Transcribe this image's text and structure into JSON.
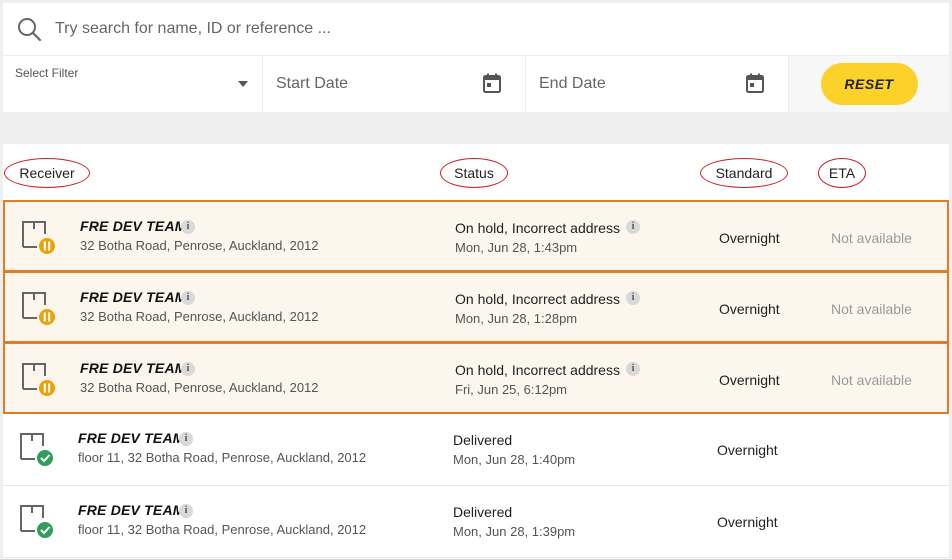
{
  "search": {
    "placeholder": "Try search for name, ID or reference ..."
  },
  "filters": {
    "select_label": "Select Filter",
    "start_date_placeholder": "Start Date",
    "end_date_placeholder": "End Date",
    "reset_label": "RESET"
  },
  "colors": {
    "accent": "#fcd12a",
    "on_hold": "#e8a30c",
    "delivered": "#2e9e5b",
    "highlight_border": "#e07b26",
    "annotation": "#d0202a"
  },
  "table": {
    "headers": {
      "receiver": "Receiver",
      "status": "Status",
      "standard": "Standard",
      "eta": "ETA"
    },
    "rows": [
      {
        "name": "FRE DEV TEAM",
        "address": "32 Botha Road, Penrose, Auckland, 2012",
        "status": "On hold, Incorrect address",
        "status_time": "Mon, Jun 28, 1:43pm",
        "standard": "Overnight",
        "eta": "Not available",
        "state_icon": "pause-icon"
      },
      {
        "name": "FRE DEV TEAM",
        "address": "32 Botha Road, Penrose, Auckland, 2012",
        "status": "On hold, Incorrect address",
        "status_time": "Mon, Jun 28, 1:28pm",
        "standard": "Overnight",
        "eta": "Not available",
        "state_icon": "pause-icon"
      },
      {
        "name": "FRE DEV TEAM",
        "address": "32 Botha Road, Penrose, Auckland, 2012",
        "status": "On hold, Incorrect address",
        "status_time": "Fri, Jun 25, 6:12pm",
        "standard": "Overnight",
        "eta": "Not available",
        "state_icon": "pause-icon"
      },
      {
        "name": "FRE DEV TEAM",
        "address": "floor 11, 32 Botha Road, Penrose, Auckland, 2012",
        "status": "Delivered",
        "status_time": "Mon, Jun 28, 1:40pm",
        "standard": "Overnight",
        "eta": "",
        "state_icon": "check-icon"
      },
      {
        "name": "FRE DEV TEAM",
        "address": "floor 11, 32 Botha Road, Penrose, Auckland, 2012",
        "status": "Delivered",
        "status_time": "Mon, Jun 28, 1:39pm",
        "standard": "Overnight",
        "eta": "",
        "state_icon": "check-icon"
      }
    ],
    "info_glyph": "i"
  }
}
